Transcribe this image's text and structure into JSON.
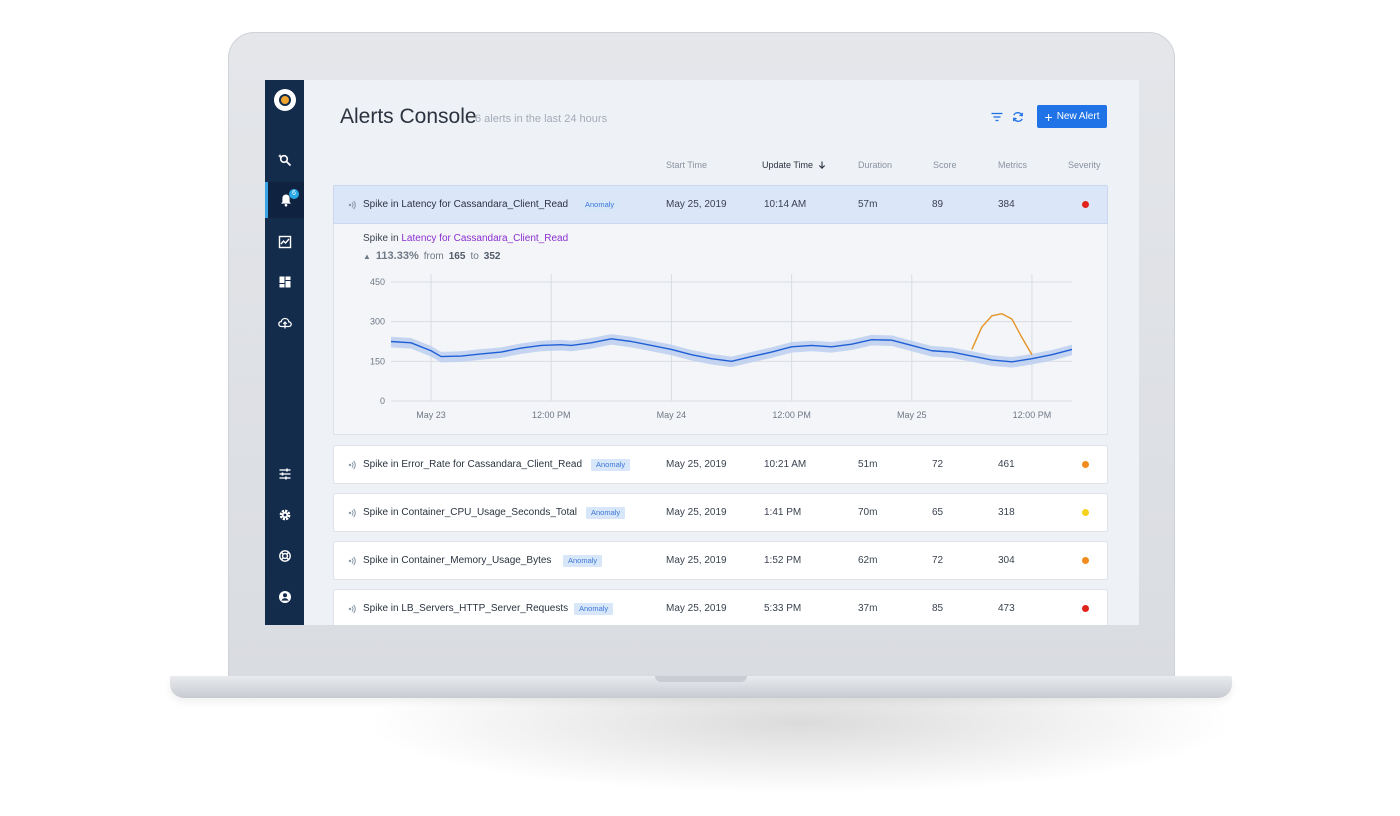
{
  "header": {
    "title": "Alerts Console",
    "subtitle": "6 alerts in the last 24 hours",
    "new_alert_label": "New Alert"
  },
  "sidebar": {
    "alerts_badge": "6",
    "items": [
      {
        "icon": "search-magic-icon"
      },
      {
        "icon": "bell-icon",
        "active": true
      },
      {
        "icon": "chart-icon"
      },
      {
        "icon": "dashboard-icon"
      },
      {
        "icon": "cloud-upload-icon"
      },
      {
        "icon": "sliders-icon"
      },
      {
        "icon": "gear-icon"
      },
      {
        "icon": "lifebuoy-icon"
      },
      {
        "icon": "user-icon"
      }
    ]
  },
  "columns": {
    "start_time": "Start Time",
    "update_time": "Update Time",
    "duration": "Duration",
    "score": "Score",
    "metrics": "Metrics",
    "severity": "Severity"
  },
  "alerts": [
    {
      "name": "Spike in Latency for Cassandara_Client_Read",
      "tag": "Anomaly",
      "start": "May 25, 2019",
      "update": "10:14 AM",
      "duration": "57m",
      "score": "89",
      "metrics": "384",
      "severity_color": "#e0241b"
    },
    {
      "name": "Spike in Error_Rate for Cassandara_Client_Read",
      "tag": "Anomaly",
      "start": "May 25, 2019",
      "update": "10:21 AM",
      "duration": "51m",
      "score": "72",
      "metrics": "461",
      "severity_color": "#f28c1c"
    },
    {
      "name": "Spike in Container_CPU_Usage_Seconds_Total",
      "tag": "Anomaly",
      "start": "May 25, 2019",
      "update": "1:41 PM",
      "duration": "70m",
      "score": "65",
      "metrics": "318",
      "severity_color": "#f6d21b"
    },
    {
      "name": "Spike in Container_Memory_Usage_Bytes",
      "tag": "Anomaly",
      "start": "May 25, 2019",
      "update": "1:52 PM",
      "duration": "62m",
      "score": "72",
      "metrics": "304",
      "severity_color": "#f28c1c"
    },
    {
      "name": "Spike in LB_Servers_HTTP_Server_Requests",
      "tag": "Anomaly",
      "start": "May 25, 2019",
      "update": "5:33 PM",
      "duration": "37m",
      "score": "85",
      "metrics": "473",
      "severity_color": "#e0241b"
    }
  ],
  "detail": {
    "prefix": "Spike in",
    "metric": "Latency for Cassandara_Client_Read",
    "change_pct": "113.33%",
    "from_label": "from",
    "from_value": "165",
    "to_label": "to",
    "to_value": "352"
  },
  "chart_data": {
    "type": "line",
    "yticks": [
      "0",
      "150",
      "300",
      "450"
    ],
    "ylim": [
      0,
      450
    ],
    "xticks": [
      "May 23",
      "12:00 PM",
      "May 24",
      "12:00 PM",
      "May 25",
      "12:00 PM"
    ],
    "x_hours": [
      0,
      12,
      24,
      36,
      48,
      60
    ],
    "xlim": [
      -4,
      64
    ],
    "series": [
      {
        "values": [
          [
            -4,
            225
          ],
          [
            -2,
            220
          ],
          [
            0,
            190
          ],
          [
            1,
            168
          ],
          [
            3,
            170
          ],
          [
            5,
            178
          ],
          [
            7,
            185
          ],
          [
            9,
            200
          ],
          [
            11,
            210
          ],
          [
            13,
            213
          ],
          [
            14,
            210
          ],
          [
            16,
            220
          ],
          [
            18,
            235
          ],
          [
            20,
            225
          ],
          [
            22,
            210
          ],
          [
            24,
            195
          ],
          [
            26,
            175
          ],
          [
            28,
            160
          ],
          [
            30,
            150
          ],
          [
            32,
            168
          ],
          [
            34,
            185
          ],
          [
            36,
            205
          ],
          [
            38,
            210
          ],
          [
            40,
            205
          ],
          [
            42,
            215
          ],
          [
            44,
            232
          ],
          [
            46,
            230
          ],
          [
            48,
            210
          ],
          [
            50,
            190
          ],
          [
            52,
            185
          ],
          [
            54,
            170
          ],
          [
            56,
            155
          ],
          [
            58,
            148
          ],
          [
            60,
            160
          ],
          [
            62,
            175
          ],
          [
            64,
            195
          ]
        ],
        "color": "#1f5fd6"
      },
      {
        "values": [
          [
            54,
            195
          ],
          [
            55,
            280
          ],
          [
            56,
            322
          ],
          [
            57,
            330
          ],
          [
            58,
            310
          ],
          [
            59,
            240
          ],
          [
            60,
            175
          ]
        ],
        "color": "#e59427"
      }
    ],
    "band_color": "#b9cdef"
  },
  "colors": {
    "sidebar": "#142c4c",
    "accent": "#1f73e6",
    "expanded_row": "#dbe6f8"
  }
}
